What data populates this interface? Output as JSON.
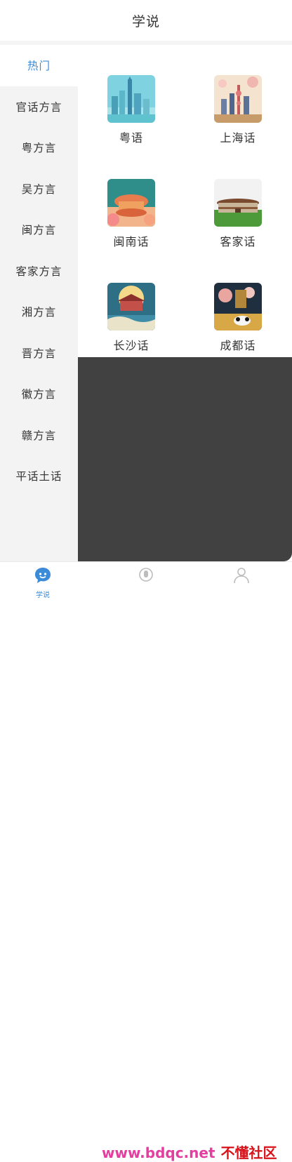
{
  "header": {
    "title": "学说"
  },
  "sidebar": {
    "items": [
      {
        "label": "热门",
        "active": true
      },
      {
        "label": "官话方言"
      },
      {
        "label": "粤方言"
      },
      {
        "label": "吴方言"
      },
      {
        "label": "闽方言"
      },
      {
        "label": "客家方言"
      },
      {
        "label": "湘方言"
      },
      {
        "label": "晋方言"
      },
      {
        "label": "徽方言"
      },
      {
        "label": "赣方言"
      },
      {
        "label": "平话土话"
      }
    ]
  },
  "grid": {
    "items": [
      {
        "label": "粤语",
        "icon": "cantonese-city-thumb"
      },
      {
        "label": "上海话",
        "icon": "shanghai-skyline-thumb"
      },
      {
        "label": "闽南话",
        "icon": "minnan-pavilion-thumb"
      },
      {
        "label": "客家话",
        "icon": "hakka-tulou-thumb"
      },
      {
        "label": "长沙话",
        "icon": "changsha-tower-thumb"
      },
      {
        "label": "成都话",
        "icon": "chengdu-panda-thumb"
      }
    ]
  },
  "tabbar": {
    "tabs": [
      {
        "label": "学说",
        "icon": "chat-bubble-icon",
        "active": true
      },
      {
        "label": "",
        "icon": "mic-icon"
      },
      {
        "label": "",
        "icon": "user-icon"
      }
    ]
  },
  "watermark": {
    "en": "www.bdqc.net",
    "cn": "不懂社区"
  },
  "colors": {
    "accent": "#3c8bd8",
    "dark": "#414141",
    "sidebar": "#f3f3f3"
  }
}
